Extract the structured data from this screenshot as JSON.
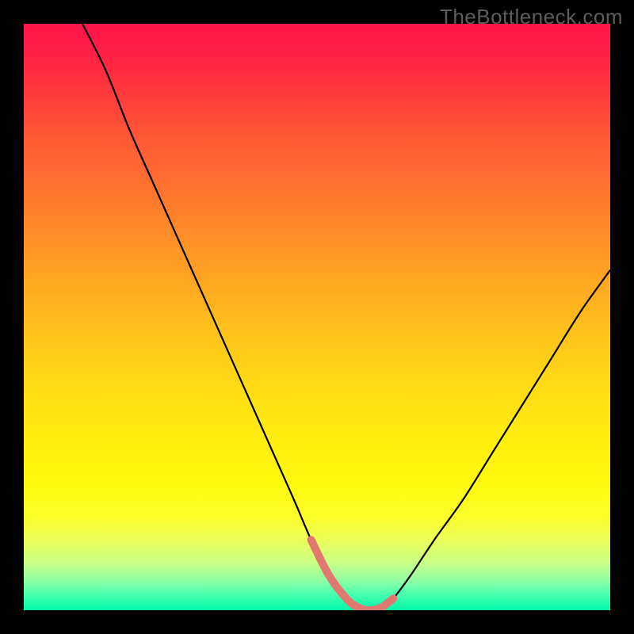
{
  "watermark": "TheBottleneck.com",
  "chart_data": {
    "type": "line",
    "title": "",
    "xlabel": "",
    "ylabel": "",
    "xlim": [
      0,
      100
    ],
    "ylim": [
      0,
      100
    ],
    "series": [
      {
        "name": "curve",
        "color": "#000000",
        "x": [
          10,
          14,
          18,
          22,
          26,
          30,
          34,
          38,
          42,
          46,
          49,
          52,
          55,
          57,
          59,
          61,
          63,
          66,
          70,
          75,
          80,
          85,
          90,
          95,
          100
        ],
        "y": [
          100,
          92,
          82,
          73,
          64,
          55,
          46,
          37,
          28,
          19,
          12,
          6,
          2,
          0.5,
          0,
          0.5,
          2,
          6,
          12,
          19,
          27,
          35,
          43,
          51,
          58
        ]
      },
      {
        "name": "trough-highlight",
        "color": "#e07a6e",
        "x": [
          49,
          52,
          55,
          57,
          59,
          61,
          63
        ],
        "y": [
          12,
          6,
          2,
          0.5,
          0,
          0.5,
          2
        ]
      }
    ],
    "annotations": []
  }
}
